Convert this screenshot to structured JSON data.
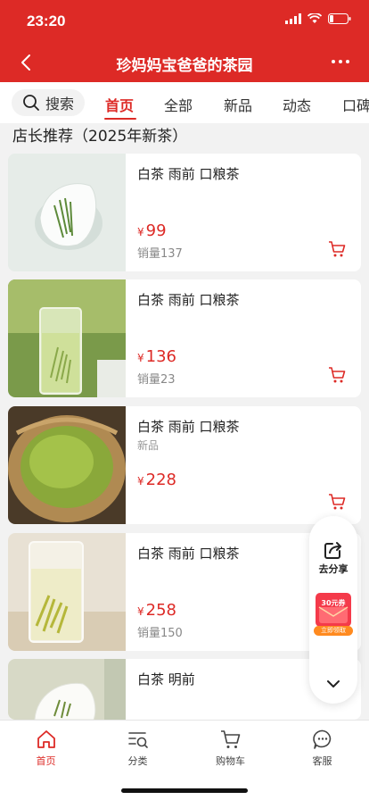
{
  "status_bar": {
    "time": "23:20"
  },
  "header": {
    "title": "珍妈妈宝爸爸的茶园"
  },
  "tabs": {
    "search_label": "搜索",
    "items": [
      "首页",
      "全部",
      "新品",
      "动态",
      "口碑"
    ],
    "active": "首页"
  },
  "section": {
    "title": "店长推荐（2025年新茶）"
  },
  "products": [
    {
      "name": "白茶 雨前 口粮茶",
      "tag": "",
      "currency": "¥",
      "price": "99",
      "sales": "销量137"
    },
    {
      "name": "白茶 雨前 口粮茶",
      "tag": "",
      "currency": "¥",
      "price": "136",
      "sales": "销量23"
    },
    {
      "name": "白茶 雨前 口粮茶",
      "tag": "新品",
      "currency": "¥",
      "price": "228",
      "sales": ""
    },
    {
      "name": "白茶 雨前 口粮茶",
      "tag": "",
      "currency": "¥",
      "price": "258",
      "sales": "销量150"
    },
    {
      "name": "白茶 明前",
      "tag": "",
      "currency": "",
      "price": "",
      "sales": ""
    }
  ],
  "floating": {
    "share_label": "去分享",
    "coupon_amount": "30元券",
    "coupon_claim": "立即领取"
  },
  "bottom_nav": {
    "items": [
      "首页",
      "分类",
      "购物车",
      "客服"
    ],
    "active": "首页"
  },
  "colors": {
    "brand_red": "#dd2a26",
    "price_red": "#dd2a26",
    "coupon_orange": "#ff8a1f"
  },
  "icons": [
    "back-icon",
    "more-icon",
    "search-icon",
    "cart-icon",
    "share-icon",
    "chevron-down-icon",
    "home-icon",
    "category-icon",
    "shopping-cart-icon",
    "customer-service-icon"
  ]
}
